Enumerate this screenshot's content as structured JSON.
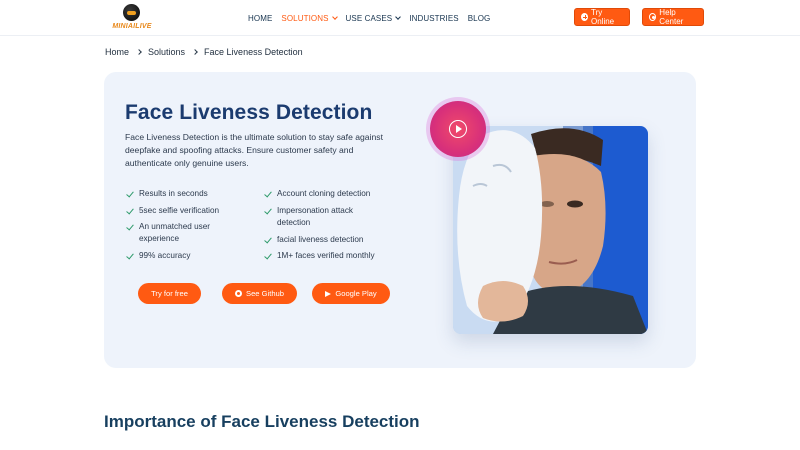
{
  "header": {
    "logo_text": "MINIAILIVE",
    "nav": [
      {
        "label": "HOME"
      },
      {
        "label": "SOLUTIONS"
      },
      {
        "label": "USE CASES"
      },
      {
        "label": "INDUSTRIES"
      },
      {
        "label": "BLOG"
      }
    ],
    "try_online": "Try Online",
    "help_center": "Help Center",
    "accent_color": "#ff5a12"
  },
  "breadcrumb": [
    "Home",
    "Solutions",
    "Face Liveness Detection"
  ],
  "hero": {
    "title": "Face Liveness Detection",
    "description": "Face Liveness Detection is the ultimate solution to stay safe against deepfake and spoofing attacks. Ensure customer safety and authenticate only genuine users.",
    "features_left": [
      "Results in seconds",
      "5sec selfie verification",
      "An unmatched user experience",
      "99% accuracy"
    ],
    "features_right": [
      "Account cloning detection",
      "Impersonation attack detection",
      "facial liveness detection",
      "1M+ faces verified monthly"
    ],
    "buttons": {
      "try": "Try for free",
      "github": "See Github",
      "play": "Google Play"
    }
  },
  "section": {
    "title": "Importance of Face Liveness Detection"
  }
}
